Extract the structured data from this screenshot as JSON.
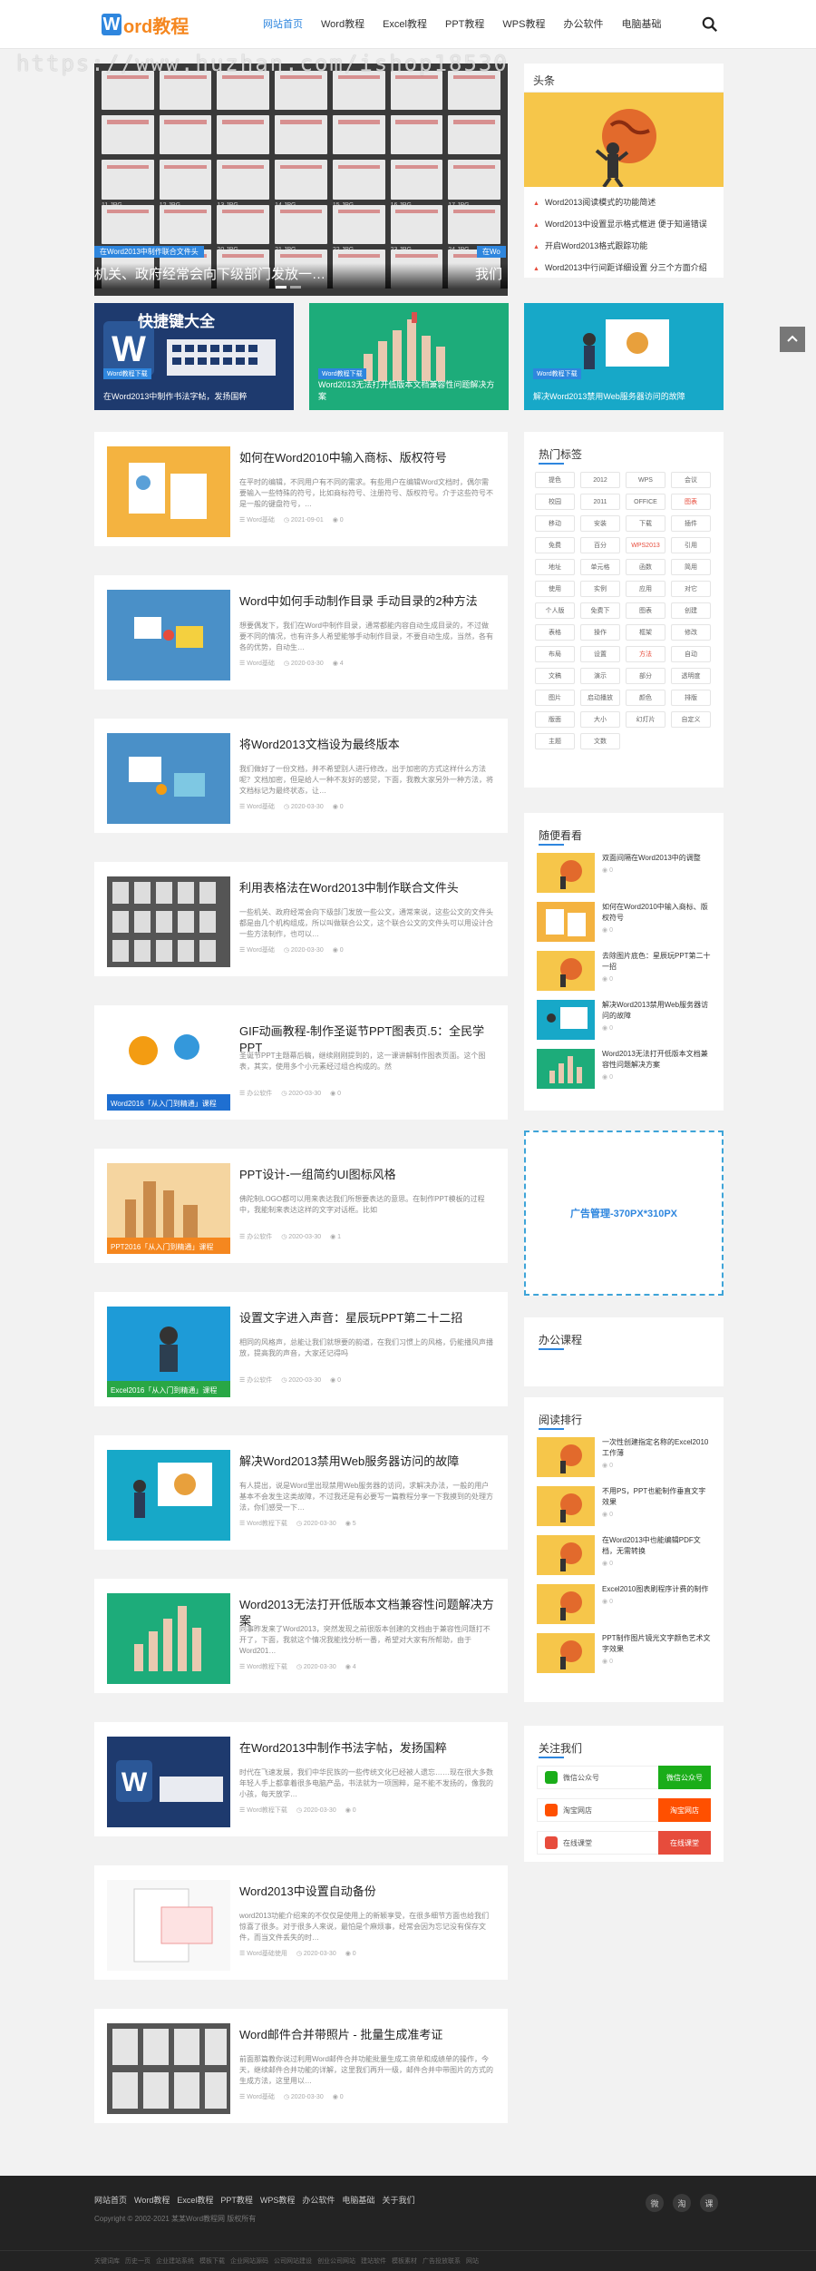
{
  "site": {
    "logo_w": "W",
    "logo_rest": "ord教程"
  },
  "nav": [
    "网站首页",
    "Word教程",
    "Excel教程",
    "PPT教程",
    "WPS教程",
    "办公软件",
    "电脑基础"
  ],
  "watermark": "https://www.huzhan.com/ishop18530",
  "slider": {
    "caption": "机关、政府经常会向下级部门发放一…",
    "caption2": "我们",
    "tag": "在Word2013中制作联合文件头",
    "tag2": "在Wo",
    "thumbs": [
      "11.JPG",
      "12.JPG",
      "13.JPG",
      "14.JPG",
      "15.JPG",
      "16.JPG",
      "17.JPG",
      "18.JPG",
      "19.JPG",
      "20.JPG",
      "21.JPG",
      "22.JPG",
      "23.JPG",
      "24.JPG"
    ]
  },
  "headline": {
    "title": "头条",
    "items": [
      "Word2013阅读模式的功能简述",
      "Word2013中设置显示格式框进 便于知道错误",
      "开启Word2013格式跟踪功能",
      "Word2013中行间距详细设置 分三个方面介绍"
    ]
  },
  "tri_cards": [
    {
      "caption": "在Word2013中制作书法字帖，发扬国粹",
      "tag": "",
      "img_text": "快捷键大全"
    },
    {
      "caption": "Word2013无法打开低版本文档兼容性问题解决方案",
      "tag": "Word教程下载",
      "img_text": ""
    },
    {
      "caption": "解决Word2013禁用Web服务器访问的故障",
      "tag": "Word教程下载",
      "img_text": ""
    }
  ],
  "first_card_tag": "Word教程下载",
  "posts": [
    {
      "title": "如何在Word2010中输入商标、版权符号",
      "desc": "在平时的编辑，不同用户有不同的需求。有些用户在编辑Word文档时，偶尔需要输入一些特殊的符号，比如商标符号、注册符号、版权符号。介于这些符号不是一般的键盘符号，…",
      "cat": "Word基础",
      "date": "2021-09-01",
      "views": "0",
      "banner": ""
    },
    {
      "title": "Word中如何手动制作目录 手动目录的2种方法",
      "desc": "想要偶发下，我们在Word中制作目录，通常都能内容自动生成目录的，不过做要不同的情况，也有许多人希望能够手动制作目录，不要自动生成，当然，各有各的优势，自动生…",
      "cat": "Word基础",
      "date": "2020-03-30",
      "views": "4",
      "banner": ""
    },
    {
      "title": "将Word2013文档设为最终版本",
      "desc": "我们做好了一份文档，并不希望别人进行修改，出于加密的方式这样什么方法呢？文档加密，但是给人一种不友好的感觉，下面，我教大家另外一种方法，将文档标记为最终状态，让…",
      "cat": "Word基础",
      "date": "2020-03-30",
      "views": "0",
      "banner": ""
    },
    {
      "title": "利用表格法在Word2013中制作联合文件头",
      "desc": "一些机关、政府经常会向下级部门发放一些公文，通常来说，这些公文的文件头都是由几个机构组成，所以叫做联合公文，这个联合公文的文件头可以用设计合一些方法制作，也可以…",
      "cat": "Word基础",
      "date": "2020-03-30",
      "views": "0",
      "banner": ""
    },
    {
      "title": "GIF动画教程-制作圣诞节PPT图表页.5：全民学PPT",
      "desc": "圣诞节PPT主题幕后稿，继续刚刚提到的，这一课讲解制作图表页面。这个图表，其实，使用多个小元素经过组合构成的。然",
      "cat": "办公软件",
      "date": "2020-03-30",
      "views": "0",
      "banner": "Word2016「从入门到精通」课程"
    },
    {
      "title": "PPT设计-一组简约UI图标风格",
      "desc": "佛陀制LOGO都可以用来表达我们所想要表达的意思。在制作PPT模板的过程中，我能制来表达这样的文字对话框。比如",
      "cat": "办公软件",
      "date": "2020-03-30",
      "views": "1",
      "banner": "PPT2016「从入门到精通」课程"
    },
    {
      "title": "设置文字进入声音：星辰玩PPT第二十二招",
      "desc": "相同的风格声，总能让我们就想要的韵道，在我们习惯上的风格，仍能播风声播放，提高我的声音，大家还记得吗",
      "cat": "办公软件",
      "date": "2020-03-30",
      "views": "0",
      "banner": "Excel2016「从入门到精通」课程"
    },
    {
      "title": "解决Word2013禁用Web服务器访问的故障",
      "desc": "有人提出，说是Word里出现禁用Web服务器的访问，求解决办法，一般的用户基本不会发生这类故障，不过我还是有必要写一篇教程分享一下我摸到的处理方法，你们感受一下…",
      "cat": "Word教程下载",
      "date": "2020-03-30",
      "views": "5",
      "banner": ""
    },
    {
      "title": "Word2013无法打开低版本文档兼容性问题解决方案",
      "desc": "同事昨发来了Word2013，突然发现之前很版本创建的文档由于兼容性问题打不开了，下面，我就这个情况我能找分析一番，希望对大家有所帮助，由于Word201…",
      "cat": "Word教程下载",
      "date": "2020-03-30",
      "views": "4",
      "banner": ""
    },
    {
      "title": "在Word2013中制作书法字帖，发扬国粹",
      "desc": "时代在飞速发展，我们中华民族的一些传统文化已经被人遗忘……现在很大多数年轻人手上都拿着很多电脑产品，书法就为一项国粹，是不能不发扬的，像我的小孩，每天放学…",
      "cat": "Word教程下载",
      "date": "2020-03-30",
      "views": "0",
      "banner": ""
    },
    {
      "title": "Word2013中设置自动备份",
      "desc": "word2013功能介绍来的不仅仅是使用上的新颖享受，在很多细节方面也给我们惊喜了很多。对于很多人来说，最怕是个麻烦事，经常会因为忘记没有保存文件，而当文件丢失的时…",
      "cat": "Word基础使用",
      "date": "2020-03-30",
      "views": "0",
      "banner": ""
    },
    {
      "title": "Word邮件合并带照片 - 批量生成准考证",
      "desc": "前面那篇教你说过利用Word邮件合并功能批量生成工资单和成绩单的操作，今天，继续邮件合并功能的详解，这里我们再升一级，邮件合并中带图片的方式的生成方法，这里用以…",
      "cat": "Word基础",
      "date": "2020-03-30",
      "views": "0",
      "banner": ""
    }
  ],
  "hot_tags": {
    "title": "热门标签",
    "items": [
      "提色",
      "2012",
      "WPS",
      "会议",
      "校园",
      "2011",
      "OFFICE",
      "图表",
      "移动",
      "安装",
      "下载",
      "插件",
      "免费",
      "百分",
      "WPS2013",
      "引用",
      "地址",
      "单元格",
      "函数",
      "简用",
      "使用",
      "实例",
      "应用",
      "对它",
      "个人版",
      "免费下",
      "图表",
      "创建",
      "表格",
      "操作",
      "框架",
      "修改",
      "布局",
      "设置",
      "方法",
      "自动",
      "文稿",
      "演示",
      "部分",
      "透明度",
      "图片",
      "启动播放",
      "颜色",
      "排版",
      "版面",
      "大小",
      "幻灯片",
      "自定义",
      "主题",
      "文数"
    ],
    "red": [
      7,
      14,
      34
    ]
  },
  "random": {
    "title": "随便看看",
    "items": [
      {
        "title": "双面间隔在Word2013中的调整",
        "views": "0"
      },
      {
        "title": "如何在Word2010中输入商标、版权符号",
        "views": "0"
      },
      {
        "title": "去除图片底色：星辰玩PPT第二十一招",
        "views": "0"
      },
      {
        "title": "解决Word2013禁用Web服务器访问的故障",
        "views": "0"
      },
      {
        "title": "Word2013无法打开低版本文档兼容性问题解决方案",
        "views": "0"
      }
    ]
  },
  "ad": {
    "text": "广告管理-370PX*310PX"
  },
  "office": {
    "title": "办公课程"
  },
  "ranking": {
    "title": "阅读排行",
    "items": [
      {
        "title": "一次性创建指定名称的Excel2010工作薄",
        "views": "0"
      },
      {
        "title": "不用PS，PPT也能制作垂直文字效果",
        "views": "0"
      },
      {
        "title": "在Word2013中也能编辑PDF文档，无需转换",
        "views": "0"
      },
      {
        "title": "Excel2010图表刷程序计费的制作",
        "views": "0"
      },
      {
        "title": "PPT制作图片镜光文字颜色艺术文字效果",
        "views": "0"
      }
    ]
  },
  "follow": {
    "title": "关注我们",
    "items": [
      {
        "label": "微信公众号",
        "button": "微信公众号",
        "color": "#1aad19"
      },
      {
        "label": "淘宝网店",
        "button": "淘宝网店",
        "color": "#ff5000"
      },
      {
        "label": "在线课堂",
        "button": "在线课堂",
        "color": "#e74c3c"
      }
    ]
  },
  "footer": {
    "links": [
      "网站首页",
      "Word教程",
      "Excel教程",
      "PPT教程",
      "WPS教程",
      "办公软件",
      "电脑基础",
      "关于我们"
    ],
    "copyright": "Copyright © 2002-2021 某某Word教程网 版权所有",
    "bottom_links": [
      "关键词库",
      "历史一页",
      "企业建站系统",
      "模板下载",
      "企业网站源码",
      "公司网站建设",
      "创业公司网站",
      "建站软件",
      "模板素材",
      "广告投放联系",
      "网站"
    ],
    "icons": [
      "微",
      "淘",
      "课"
    ]
  },
  "colors": {
    "accent": "#2e86de",
    "orange": "#f5871f",
    "yellow": "#f6c64a"
  }
}
